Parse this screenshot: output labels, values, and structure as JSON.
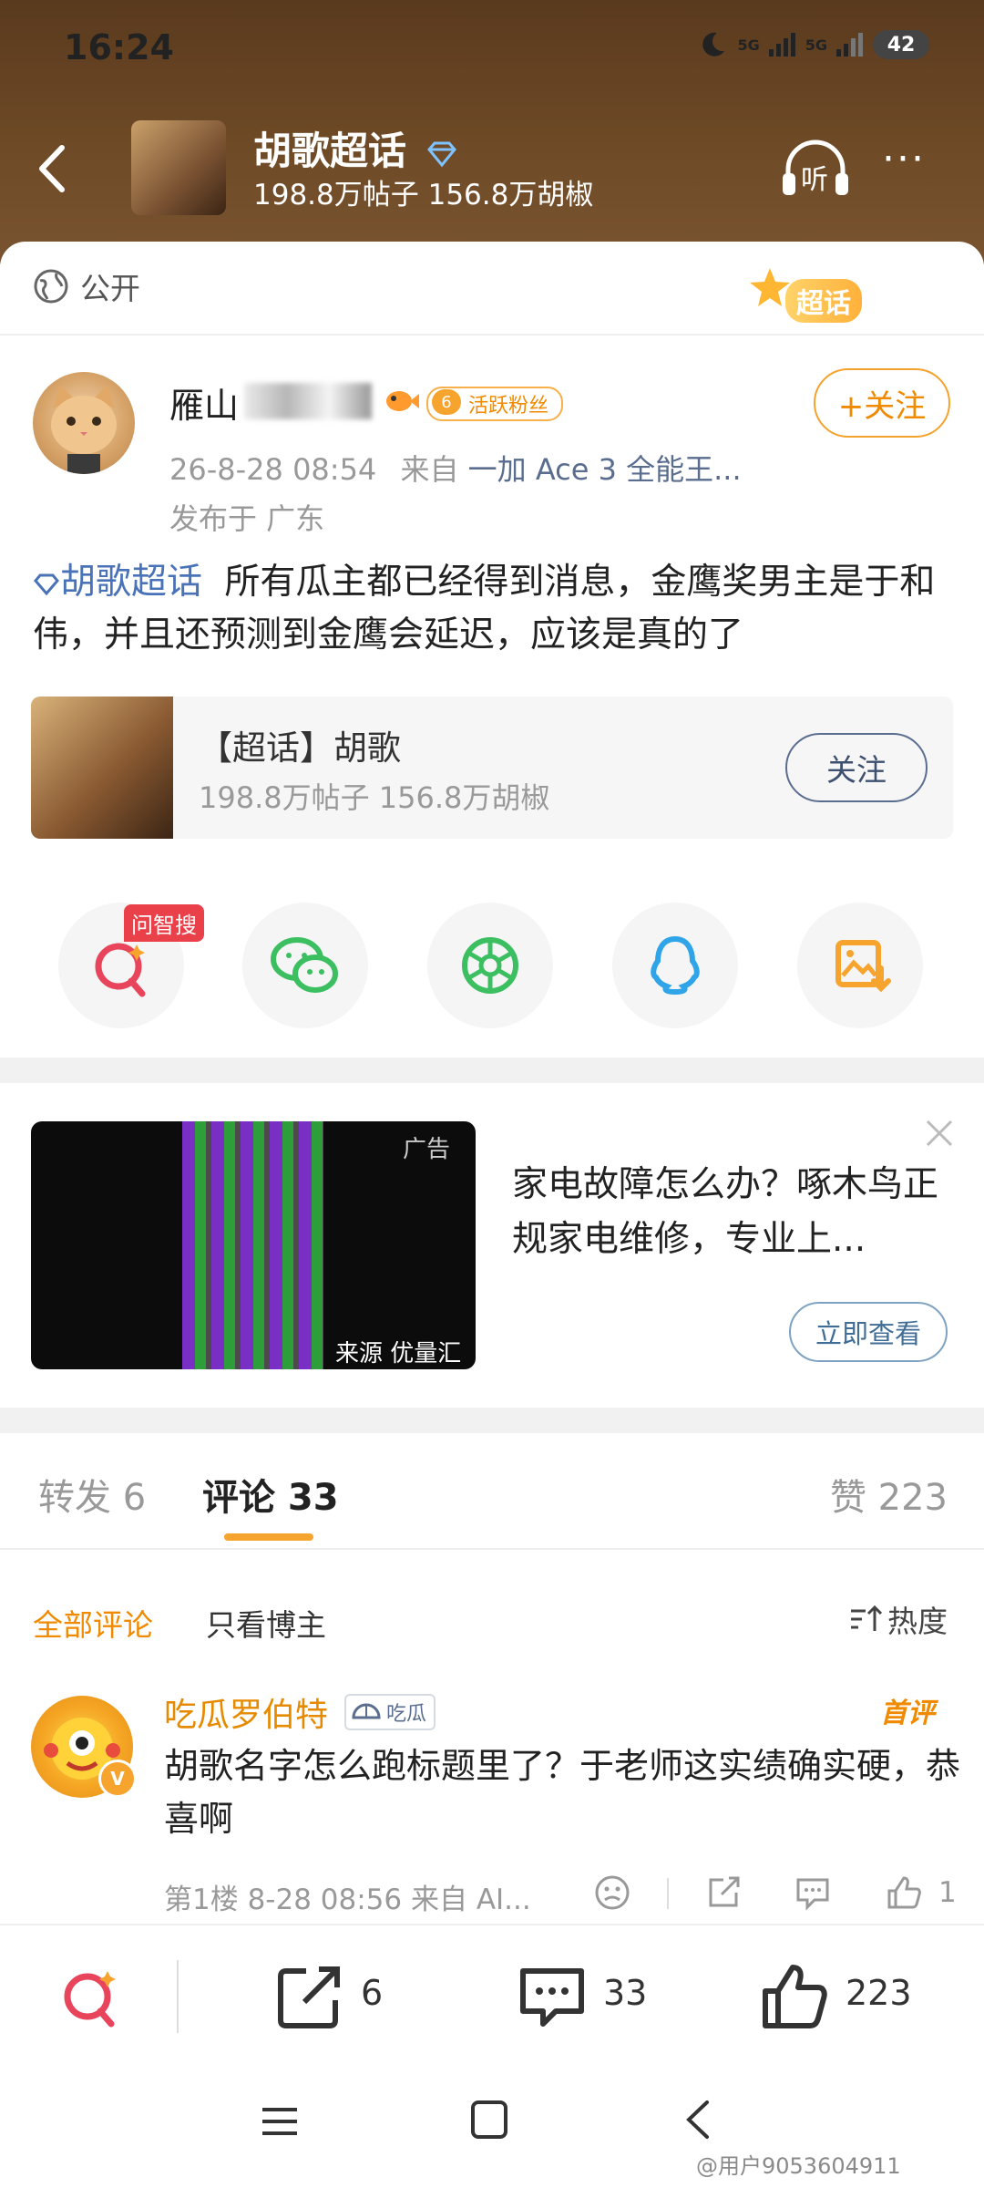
{
  "status_bar": {
    "time": "16:24",
    "network1": "5G",
    "network2": "5G",
    "battery": "42"
  },
  "header": {
    "title": "胡歌超话",
    "stats": "198.8万帖子 156.8万胡椒",
    "listen_label": "听",
    "more_label": "···"
  },
  "post": {
    "visibility": "公开",
    "chaohua_badge": "超话",
    "username": "雁山",
    "fan_level": "6",
    "fan_badge": "活跃粉丝",
    "follow_label": "+关注",
    "timestamp": "26-8-28 08:54",
    "source_prefix": "来自",
    "source": "一加 Ace 3 全能王...",
    "location": "发布于 广东",
    "tag": "胡歌超话",
    "text": "所有瓜主都已经得到消息，金鹰奖男主是于和伟，并且还预测到金鹰会延迟，应该是真的了"
  },
  "topic_card": {
    "title": "【超话】胡歌",
    "stats": "198.8万帖子 156.8万胡椒",
    "follow_label": "关注"
  },
  "share": {
    "wenzhisou_tag": "问智搜"
  },
  "ad": {
    "label": "广告",
    "source": "来源 优量汇",
    "text": "家电故障怎么办？啄木鸟正规家电维修，专业上...",
    "cta": "立即查看"
  },
  "tabs": {
    "repost": "转发 6",
    "comment": "评论 33",
    "like": "赞 223"
  },
  "filters": {
    "all": "全部评论",
    "author_only": "只看博主",
    "sort": "热度"
  },
  "comment": {
    "name": "吃瓜罗伯特",
    "badge": "吃瓜",
    "first_label": "首评",
    "text": "胡歌名字怎么跑标题里了？于老师这实绩确实硬，恭喜啊",
    "meta": "第1楼 8-28 08:56 来自 AI...",
    "like_count": "1"
  },
  "bottom_bar": {
    "repost_count": "6",
    "comment_count": "33",
    "like_count": "223"
  },
  "watermark": "@用户9053604911",
  "colors": {
    "accent": "#f7a42e",
    "link": "#4a72b8",
    "header_bg": "#6e4a26"
  }
}
